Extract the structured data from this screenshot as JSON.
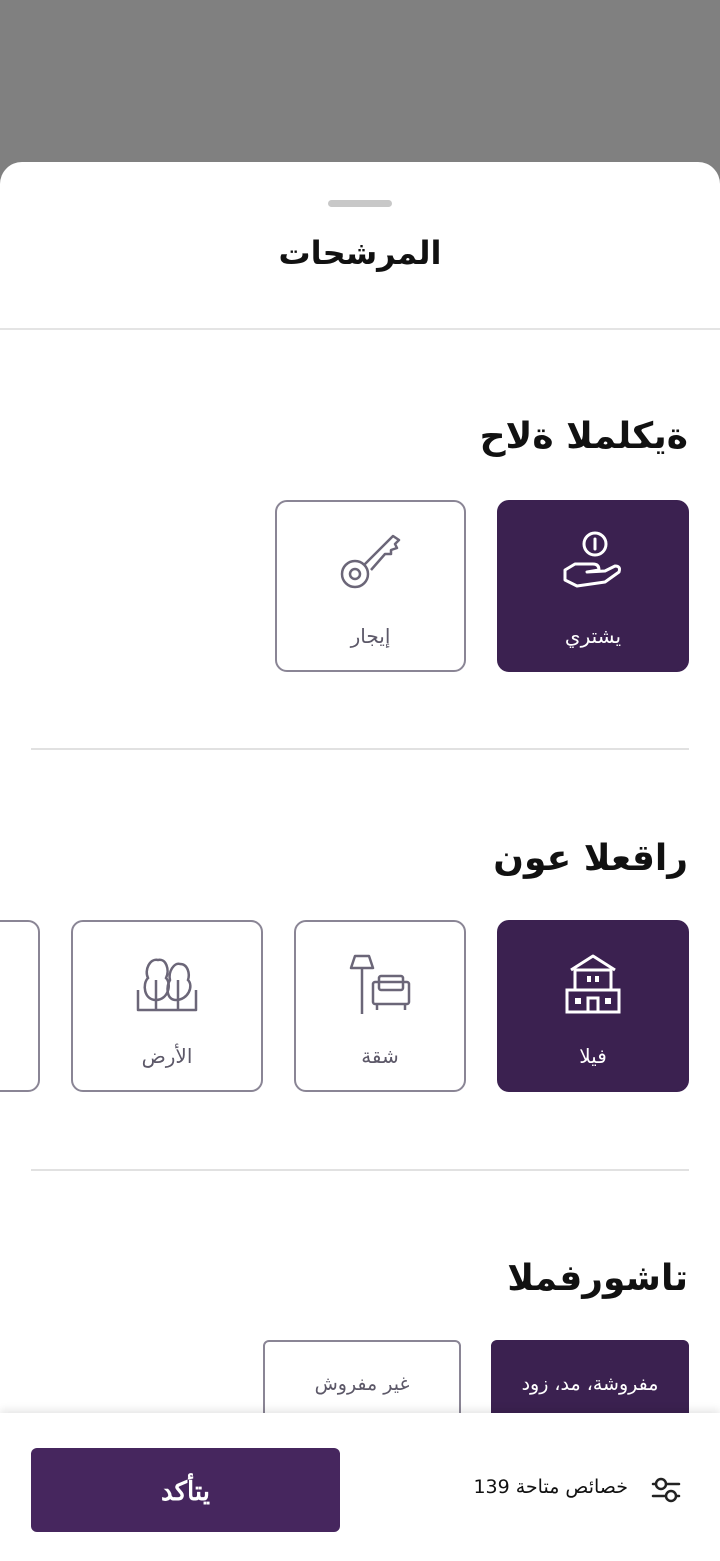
{
  "sheet": {
    "title": "المرشحات"
  },
  "sections": [
    {
      "title": "ةيكلملا ةلاح",
      "options": [
        {
          "label": "يشتري",
          "icon": "hand-coin-icon",
          "selected": true
        },
        {
          "label": "إيجار",
          "icon": "key-icon",
          "selected": false
        }
      ]
    },
    {
      "title": "راقعلا عون",
      "options": [
        {
          "label": "فيلا",
          "icon": "villa-icon",
          "selected": true
        },
        {
          "label": "شقة",
          "icon": "sofa-lamp-icon",
          "selected": false
        },
        {
          "label": "الأرض",
          "icon": "trees-land-icon",
          "selected": false
        }
      ]
    },
    {
      "title": "تاشورفملا",
      "options": [
        {
          "label": "مفروشة، مد، زود",
          "selected": true
        },
        {
          "label": "غير مفروش",
          "selected": false
        }
      ]
    }
  ],
  "footer": {
    "available_text": "139 خصائص متاحة",
    "confirm_label": "يتأكد",
    "filter_icon": "filter-icon"
  },
  "colors": {
    "accent": "#3b2150",
    "button": "#46265e",
    "border": "#8a8595",
    "backdrop": "#808080"
  }
}
